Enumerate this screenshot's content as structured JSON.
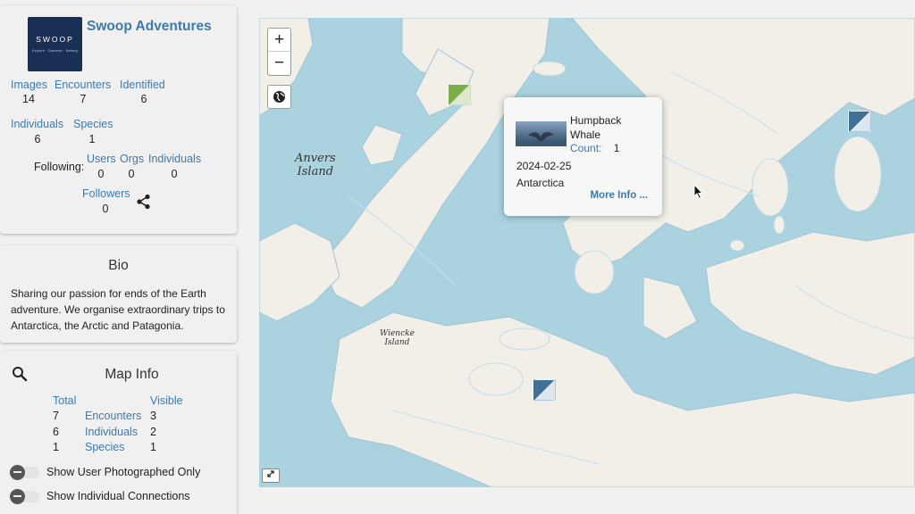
{
  "profile": {
    "name": "Swoop Adventures",
    "logo_text": "SWOOP",
    "logo_tagline": "Explore · Discover · Belong",
    "stats": {
      "images_label": "Images",
      "images_value": "14",
      "encounters_label": "Encounters",
      "encounters_value": "7",
      "identified_label": "Identified",
      "identified_value": "6",
      "individuals_label": "Individuals",
      "individuals_value": "6",
      "species_label": "Species",
      "species_value": "1"
    },
    "following": {
      "label": "Following:",
      "users_label": "Users",
      "users_value": "0",
      "orgs_label": "Orgs",
      "orgs_value": "0",
      "individuals_label": "Individuals",
      "individuals_value": "0"
    },
    "followers_label": "Followers",
    "followers_value": "0",
    "share_icon": "share-icon"
  },
  "bio": {
    "title": "Bio",
    "text": "Sharing our passion for ends of the Earth adventure. We organise extraordinary trips to Antarctica, the Arctic and Patagonia."
  },
  "map_info": {
    "title": "Map Info",
    "search_icon": "search-icon",
    "col_total": "Total",
    "col_visible": "Visible",
    "rows": [
      {
        "total": "7",
        "label": "Encounters",
        "visible": "3"
      },
      {
        "total": "6",
        "label": "Individuals",
        "visible": "2"
      },
      {
        "total": "1",
        "label": "Species",
        "visible": "1"
      }
    ],
    "toggles": [
      {
        "label": "Show User Photographed Only"
      },
      {
        "label": "Show Individual Connections"
      }
    ]
  },
  "map": {
    "zoom_in": "+",
    "zoom_out": "−",
    "labels": {
      "anvers": "Anvers\nIsland",
      "wiencke": "Wiencke\nIsland"
    },
    "popup": {
      "species": "Humpback Whale",
      "count_label": "Count:",
      "count_value": "1",
      "date": "2024-02-25",
      "location": "Antarctica",
      "more": "More Info ..."
    }
  },
  "colors": {
    "accent": "#3d7aab",
    "water": "#aad3df",
    "land": "#f2efe9",
    "marker_blue": "#3f7096",
    "marker_green": "#79ae4a"
  }
}
